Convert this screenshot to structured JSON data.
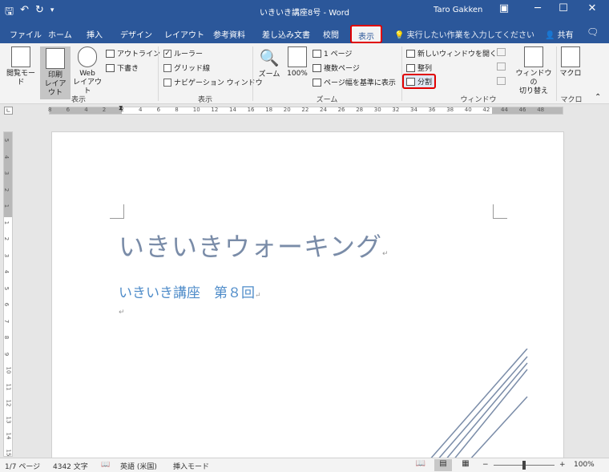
{
  "titlebar": {
    "doc_title": "いきいき講座8号 - Word",
    "user": "Taro Gakken",
    "icons": [
      "save-icon",
      "undo-icon",
      "redo-icon",
      "qat-customize-icon",
      "ribbon-display-icon",
      "minimize-icon",
      "maximize-icon",
      "close-icon"
    ]
  },
  "tabs": {
    "items": [
      "ファイル",
      "ホーム",
      "挿入",
      "デザイン",
      "レイアウト",
      "参考資料",
      "差し込み文書",
      "校閲",
      "表示"
    ],
    "active": "表示",
    "tell_me": "実行したい作業を入力してください",
    "share": "共有"
  },
  "ribbon": {
    "views": {
      "read_mode": "閲覧モード",
      "print_layout_1": "印刷",
      "print_layout_2": "レイアウト",
      "web_1": "Web",
      "web_2": "レイアウト",
      "outline": "アウトライン",
      "draft": "下書き",
      "label": "表示"
    },
    "show": {
      "ruler": "ルーラー",
      "ruler_checked": true,
      "gridlines": "グリッド線",
      "gridlines_checked": false,
      "nav_pane": "ナビゲーション ウィンドウ",
      "nav_pane_checked": false,
      "label": "表示"
    },
    "zoom": {
      "zoom": "ズーム",
      "hundred": "100%",
      "one_page": "1 ページ",
      "multi_page": "複数ページ",
      "page_width": "ページ幅を基準に表示",
      "label": "ズーム"
    },
    "window": {
      "new_window": "新しいウィンドウを開く",
      "arrange": "整列",
      "split": "分割",
      "switch_1": "ウィンドウの",
      "switch_2": "切り替え",
      "label": "ウィンドウ"
    },
    "macro": {
      "macro": "マクロ",
      "label": "マクロ"
    }
  },
  "ruler": {
    "h_numbers": [
      "8",
      "6",
      "4",
      "2",
      "2",
      "4",
      "6",
      "8",
      "10",
      "12",
      "14",
      "16",
      "18",
      "20",
      "22",
      "24",
      "26",
      "28",
      "30",
      "32",
      "34",
      "36",
      "38",
      "40",
      "42",
      "44",
      "46",
      "48"
    ],
    "v_numbers": [
      "5",
      "4",
      "3",
      "2",
      "1",
      "1",
      "2",
      "3",
      "4",
      "5",
      "6",
      "7",
      "8",
      "9",
      "10",
      "11",
      "12",
      "13",
      "14",
      "15"
    ]
  },
  "document": {
    "title": "いきいきウォーキング",
    "subtitle": "いきいき講座　第８回",
    "para_mark": "↵"
  },
  "status": {
    "page": "1/7 ページ",
    "words": "4342 文字",
    "lang": "英語 (米国)",
    "mode": "挿入モード",
    "zoom_minus": "−",
    "zoom_plus": "+",
    "zoom": "100%",
    "zoom_level_percent": 100
  },
  "colors": {
    "word_blue": "#2b579a",
    "highlight_red": "#e00000",
    "title_color": "#7a8ca8",
    "subtitle_color": "#4f8cc9"
  }
}
